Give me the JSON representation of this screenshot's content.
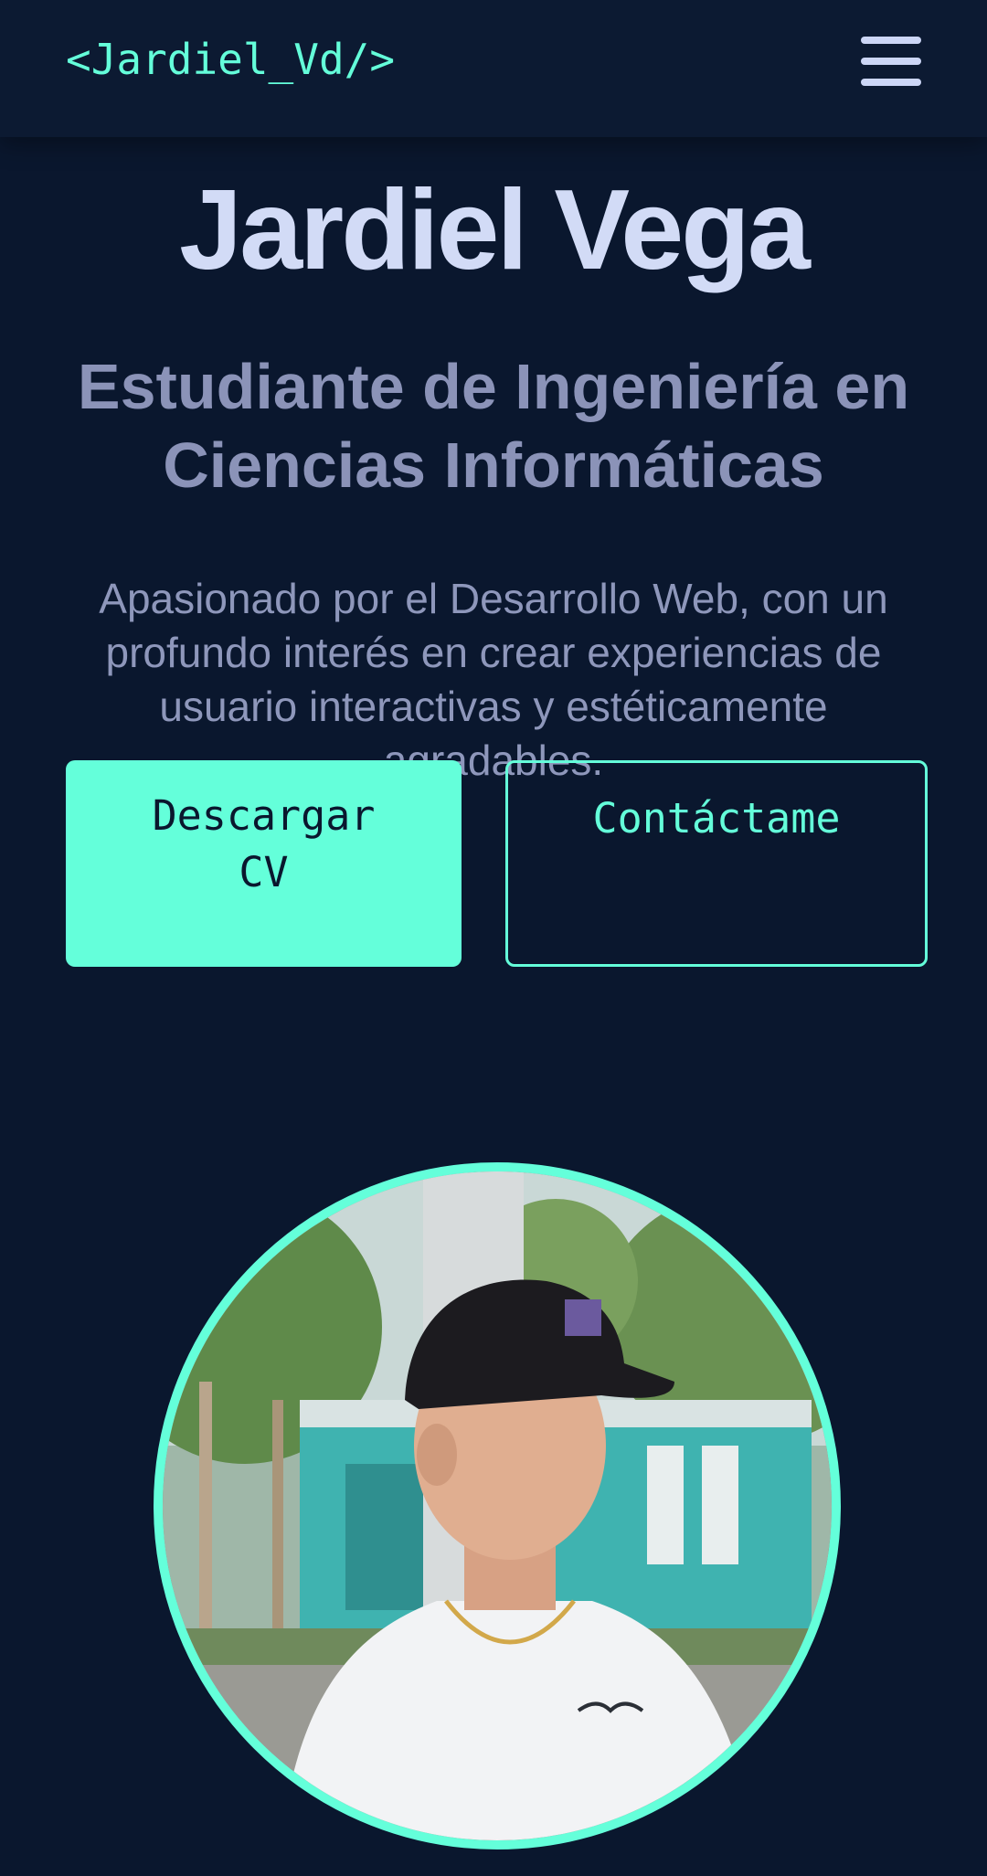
{
  "navbar": {
    "logo": "<Jardiel_Vd/>",
    "menu_icon": "hamburger-menu-icon"
  },
  "hero": {
    "name": "Jardiel Vega",
    "subtitle": "Estudiante de Ingeniería en Ciencias Informáticas",
    "description": "Apasionado por el Desarrollo Web, con un profundo interés en crear experiencias de usuario interactivas y estéticamente agradables."
  },
  "buttons": {
    "download_cv": "Descargar CV",
    "contact": "Contáctame"
  },
  "colors": {
    "background": "#0a172e",
    "accent": "#64ffda",
    "heading": "#d2dbf6",
    "muted": "#8b93b8"
  }
}
